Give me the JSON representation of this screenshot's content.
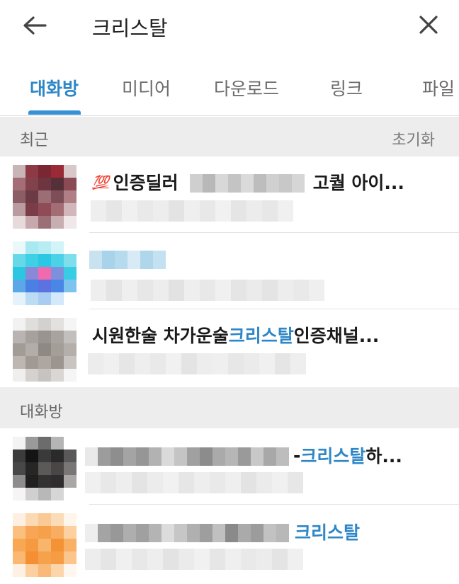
{
  "search": {
    "query": "크리스탈"
  },
  "tabs": [
    {
      "label": "대화방"
    },
    {
      "label": "미디어"
    },
    {
      "label": "다운로드"
    },
    {
      "label": "링크"
    },
    {
      "label": "파일"
    }
  ],
  "sections": {
    "recent": {
      "label": "최근",
      "action": "초기화"
    },
    "chats": {
      "label": "대화방"
    }
  },
  "recent_items": [
    {
      "emoji": "💯",
      "title_start": "인증딜러",
      "title_end": "고퀄 아이..."
    },
    {
      "title_start": ""
    },
    {
      "title_start": "시원한술 차가운술 ",
      "highlight": "크리스탈",
      "title_end": " 인증채널..."
    }
  ],
  "chat_items": [
    {
      "title_start": "- ",
      "highlight": "크리스탈",
      "title_end": " 하..."
    },
    {
      "title_start": "",
      "highlight": "크리스탈",
      "title_end": ""
    }
  ],
  "colors": {
    "accent": "#2e86c7",
    "section_bg": "#ededed"
  }
}
